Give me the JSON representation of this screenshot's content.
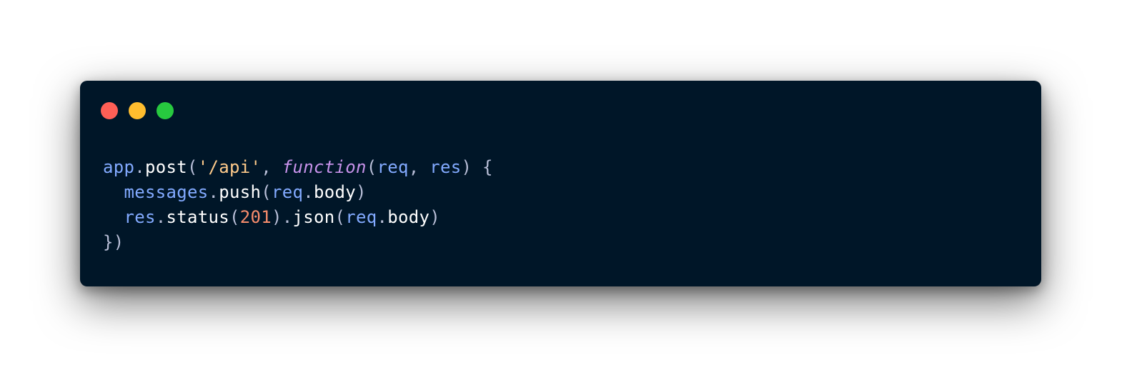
{
  "window": {
    "controls": [
      {
        "name": "close",
        "color": "#ff5f56"
      },
      {
        "name": "minimize",
        "color": "#ffbd2e"
      },
      {
        "name": "maximize",
        "color": "#27c93f"
      }
    ]
  },
  "code": {
    "lines": [
      [
        {
          "t": "app",
          "k": "ident"
        },
        {
          "t": ".",
          "k": "punc"
        },
        {
          "t": "post",
          "k": "prop"
        },
        {
          "t": "(",
          "k": "punc"
        },
        {
          "t": "'/api'",
          "k": "str"
        },
        {
          "t": ", ",
          "k": "punc"
        },
        {
          "t": "function",
          "k": "kw"
        },
        {
          "t": "(",
          "k": "punc"
        },
        {
          "t": "req",
          "k": "ident"
        },
        {
          "t": ", ",
          "k": "punc"
        },
        {
          "t": "res",
          "k": "ident"
        },
        {
          "t": ") {",
          "k": "punc"
        }
      ],
      [
        {
          "t": "  ",
          "k": "plain"
        },
        {
          "t": "messages",
          "k": "ident"
        },
        {
          "t": ".",
          "k": "punc"
        },
        {
          "t": "push",
          "k": "prop"
        },
        {
          "t": "(",
          "k": "punc"
        },
        {
          "t": "req",
          "k": "ident"
        },
        {
          "t": ".",
          "k": "punc"
        },
        {
          "t": "body",
          "k": "prop"
        },
        {
          "t": ")",
          "k": "punc"
        }
      ],
      [
        {
          "t": "  ",
          "k": "plain"
        },
        {
          "t": "res",
          "k": "ident"
        },
        {
          "t": ".",
          "k": "punc"
        },
        {
          "t": "status",
          "k": "prop"
        },
        {
          "t": "(",
          "k": "punc"
        },
        {
          "t": "201",
          "k": "num"
        },
        {
          "t": ").",
          "k": "punc"
        },
        {
          "t": "json",
          "k": "prop"
        },
        {
          "t": "(",
          "k": "punc"
        },
        {
          "t": "req",
          "k": "ident"
        },
        {
          "t": ".",
          "k": "punc"
        },
        {
          "t": "body",
          "k": "prop"
        },
        {
          "t": ")",
          "k": "punc"
        }
      ],
      [
        {
          "t": "})",
          "k": "punc"
        }
      ]
    ]
  }
}
